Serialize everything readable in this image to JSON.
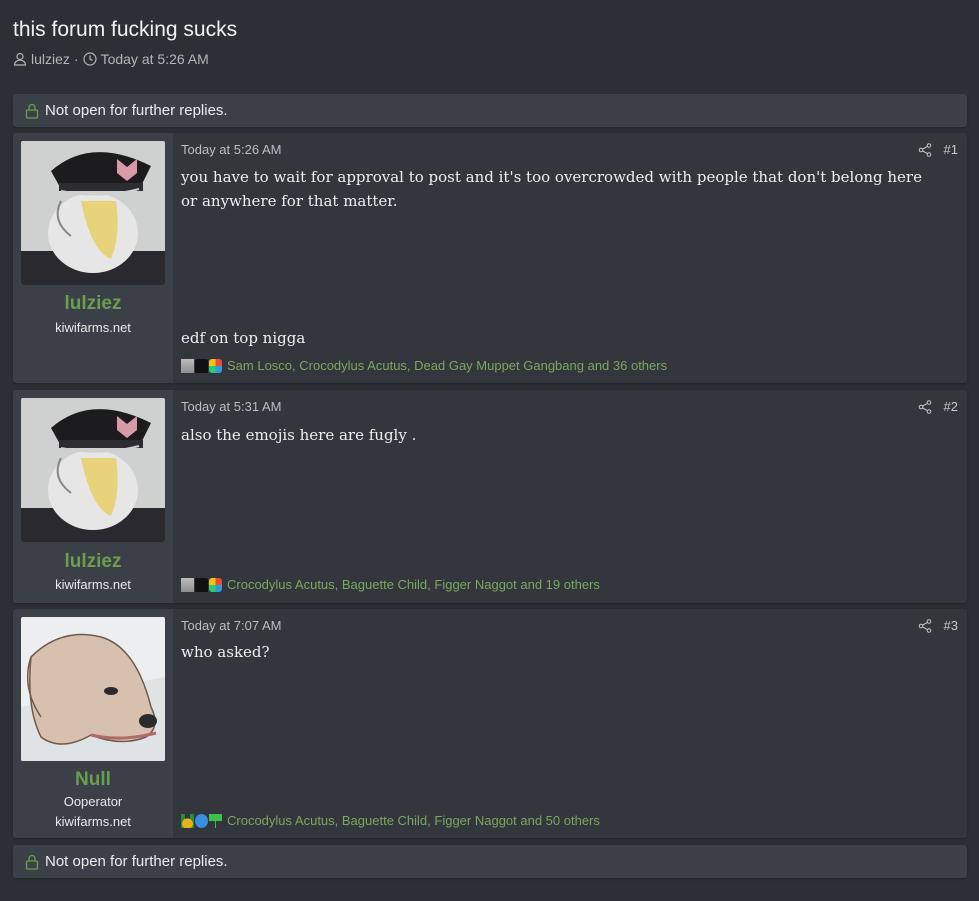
{
  "thread": {
    "title": "this forum fucking sucks",
    "author": "lulziez",
    "separator": "·",
    "date": "Today at 5:26 AM"
  },
  "notice": {
    "text": "Not open for further replies."
  },
  "posts": [
    {
      "username": "lulziez",
      "user_title": "",
      "site": "kiwifarms.net",
      "date": "Today at 5:26 AM",
      "number": "#1",
      "body1": "you have to wait for approval to post and it's too overcrowded with people that don't belong here or anywhere for that matter.",
      "body2": "edf on top nigga",
      "reactions": "Sam Losco, Crocodylus Acutus, Dead Gay Muppet Gangbang and 36 others",
      "reaction_icons": [
        "building-icon",
        "tophat-icon",
        "puzzle-icon"
      ]
    },
    {
      "username": "lulziez",
      "user_title": "",
      "site": "kiwifarms.net",
      "date": "Today at 5:31 AM",
      "number": "#2",
      "body1": "also the emojis here are fugly .",
      "reactions": "Crocodylus Acutus, Baguette Child, Figger Naggot and 19 others",
      "reaction_icons": [
        "building-icon",
        "tophat-icon",
        "puzzle-icon"
      ]
    },
    {
      "username": "Null",
      "user_title": "Ooperator",
      "site": "kiwifarms.net",
      "date": "Today at 7:07 AM",
      "number": "#3",
      "body1": "who asked?",
      "reactions": "Crocodylus Acutus, Baguette Child, Figger Naggot and 50 others",
      "reaction_icons": [
        "medal-icon",
        "thumbs-up-icon",
        "cocktail-icon"
      ]
    }
  ]
}
